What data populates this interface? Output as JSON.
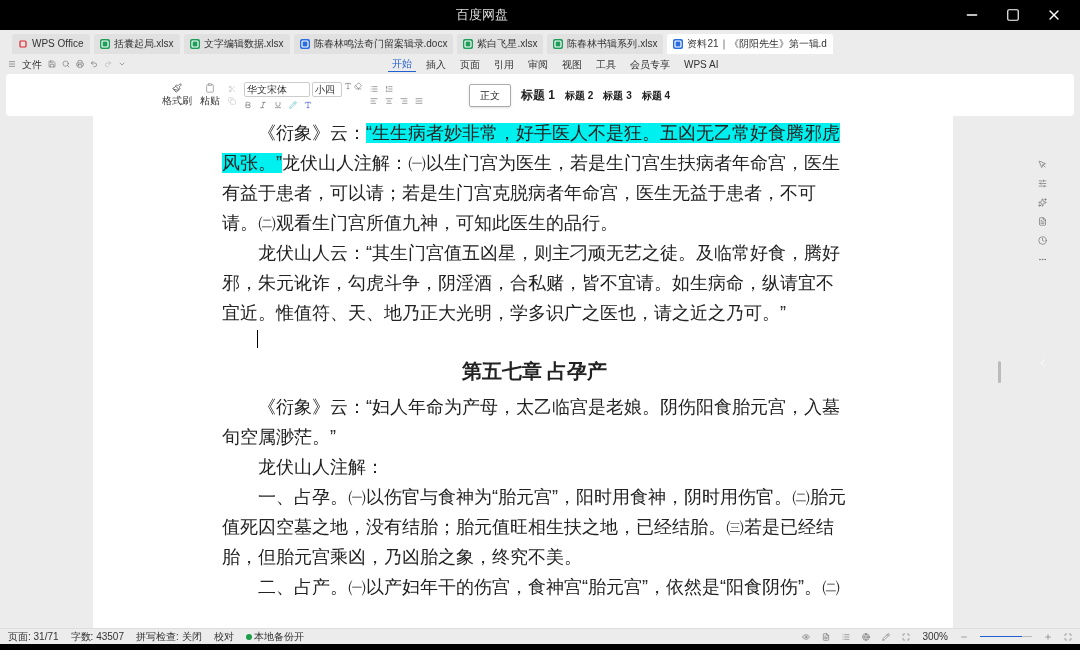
{
  "window": {
    "title": "百度网盘"
  },
  "tabs": [
    {
      "kind": "home",
      "label": "WPS Office",
      "selected": false
    },
    {
      "kind": "sheet",
      "label": "括囊起局.xlsx",
      "selected": false
    },
    {
      "kind": "sheet",
      "label": "文字编辑数据.xlsx",
      "selected": false
    },
    {
      "kind": "doc",
      "label": "陈春林鸣法奇门留案辑录.docx",
      "selected": false
    },
    {
      "kind": "sheet",
      "label": "紫白飞星.xlsx",
      "selected": false
    },
    {
      "kind": "sheet",
      "label": "陈春林书辑系列.xlsx",
      "selected": false
    },
    {
      "kind": "doc",
      "label": "资料21｜《阴阳先生》第一辑.d",
      "selected": true
    }
  ],
  "menu": {
    "file": "文件",
    "ribbon_tabs": [
      {
        "label": "开始",
        "selected": true
      },
      {
        "label": "插入",
        "selected": false
      },
      {
        "label": "页面",
        "selected": false
      },
      {
        "label": "引用",
        "selected": false
      },
      {
        "label": "审阅",
        "selected": false
      },
      {
        "label": "视图",
        "selected": false
      },
      {
        "label": "工具",
        "selected": false
      },
      {
        "label": "会员专享",
        "selected": false
      },
      {
        "label": "WPS AI",
        "selected": false
      }
    ]
  },
  "ribbon": {
    "format_painter": "格式刷",
    "paste": "粘贴",
    "font": "华文宋体",
    "size": "小四",
    "styles": [
      {
        "label": "正文",
        "selected": true
      },
      {
        "label": "标题 1",
        "selected": false
      },
      {
        "label": "标题 2",
        "selected": false
      },
      {
        "label": "标题 3",
        "selected": false
      },
      {
        "label": "标题 4",
        "selected": false
      }
    ]
  },
  "document": {
    "blocks": [
      {
        "kind": "para",
        "segments": [
          {
            "text": "《衍象》云：",
            "highlighted": false
          },
          {
            "text": "“生生病者妙非常，好手医人不是狂。五凶无乙常好食腾邪虎风张。”",
            "highlighted": true
          },
          {
            "text": "龙伏山人注解：㈠以生门宫为医生，若是生门宫生扶病者年命宫，医生有益于患者，可以请；若是生门宫克脱病者年命宫，医生无益于患者，不可请。㈡观看生门宫所值九神，可知此医生的品行。",
            "highlighted": false
          }
        ]
      },
      {
        "kind": "para",
        "segments": [
          {
            "text": "龙伏山人云：“其生门宫值五凶星，则主刁顽无艺之徒。及临常好食，腾好邪，朱元讹诈，勾虎斗争，阴淫酒，合私赌，皆不宜请。如生病命，纵请宜不宜近。惟值符、天、地乃正大光明，学多识广之医也，请之近之乃可。”",
            "highlighted": false
          }
        ]
      },
      {
        "kind": "cursor"
      },
      {
        "kind": "heading",
        "segments": [
          {
            "text": "第五七章  占孕产",
            "highlighted": false
          }
        ]
      },
      {
        "kind": "para",
        "segments": [
          {
            "text": "《衍象》云：“妇人年命为产母，太乙临宫是老娘。阴伤阳食胎元宫，入墓旬空属渺茫。”",
            "highlighted": false
          }
        ]
      },
      {
        "kind": "para",
        "segments": [
          {
            "text": "龙伏山人注解：",
            "highlighted": false
          }
        ]
      },
      {
        "kind": "para",
        "segments": [
          {
            "text": "一、占孕。㈠以伤官与食神为“胎元宫”，阳时用食神，阴时用伤官。㈡胎元值死囚空墓之地，没有结胎；胎元值旺相生扶之地，已经结胎。㈢若是已经结胎，但胎元宫乘凶，乃凶胎之象，终究不美。",
            "highlighted": false
          }
        ]
      },
      {
        "kind": "para",
        "segments": [
          {
            "text": "二、占产。㈠以产妇年干的伤宫，食神宫“胎元宫”，依然是“阳食阴伤”。㈡",
            "highlighted": false
          }
        ]
      }
    ]
  },
  "status_bar": {
    "page": "页面: 31/71",
    "words": "字数: 43507",
    "spell": "拼写检查: 关闭",
    "proof": "校对",
    "backup": "本地备份开",
    "zoom": "300%",
    "zoom_level": {
      "level": 0.8
    }
  }
}
